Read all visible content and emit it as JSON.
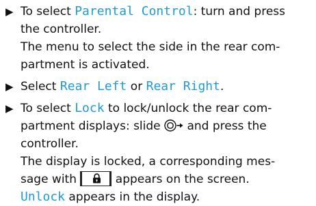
{
  "step1": {
    "line1_pre": "To select ",
    "term": "Parental Control",
    "line1_post": ": turn and press",
    "line2": "the controller.",
    "result_line1": "The menu to select the side in the rear com-",
    "result_line2": "partment is activated."
  },
  "step2": {
    "pre": "Select ",
    "term_a": "Rear Left",
    "mid": " or ",
    "term_b": "Rear Right",
    "post": "."
  },
  "step3": {
    "line1_pre": "To select ",
    "term": "Lock",
    "line1_post": " to lock/unlock the rear com-",
    "line2_pre": "partment displays: slide ",
    "line2_post": " and press the",
    "line3": "controller.",
    "result_line1": "The display is locked, a corresponding mes-",
    "result_line2_pre": "sage with ",
    "result_line2_post": " appears on the screen.",
    "result_line3_term": "Unlock",
    "result_line3_post": " appears in the display."
  },
  "icons": [
    "bullet-arrow-icon",
    "controller-slide-right-icon",
    "padlock-icon"
  ],
  "colors": {
    "term": "#1e9ad6",
    "text": "#111111"
  }
}
